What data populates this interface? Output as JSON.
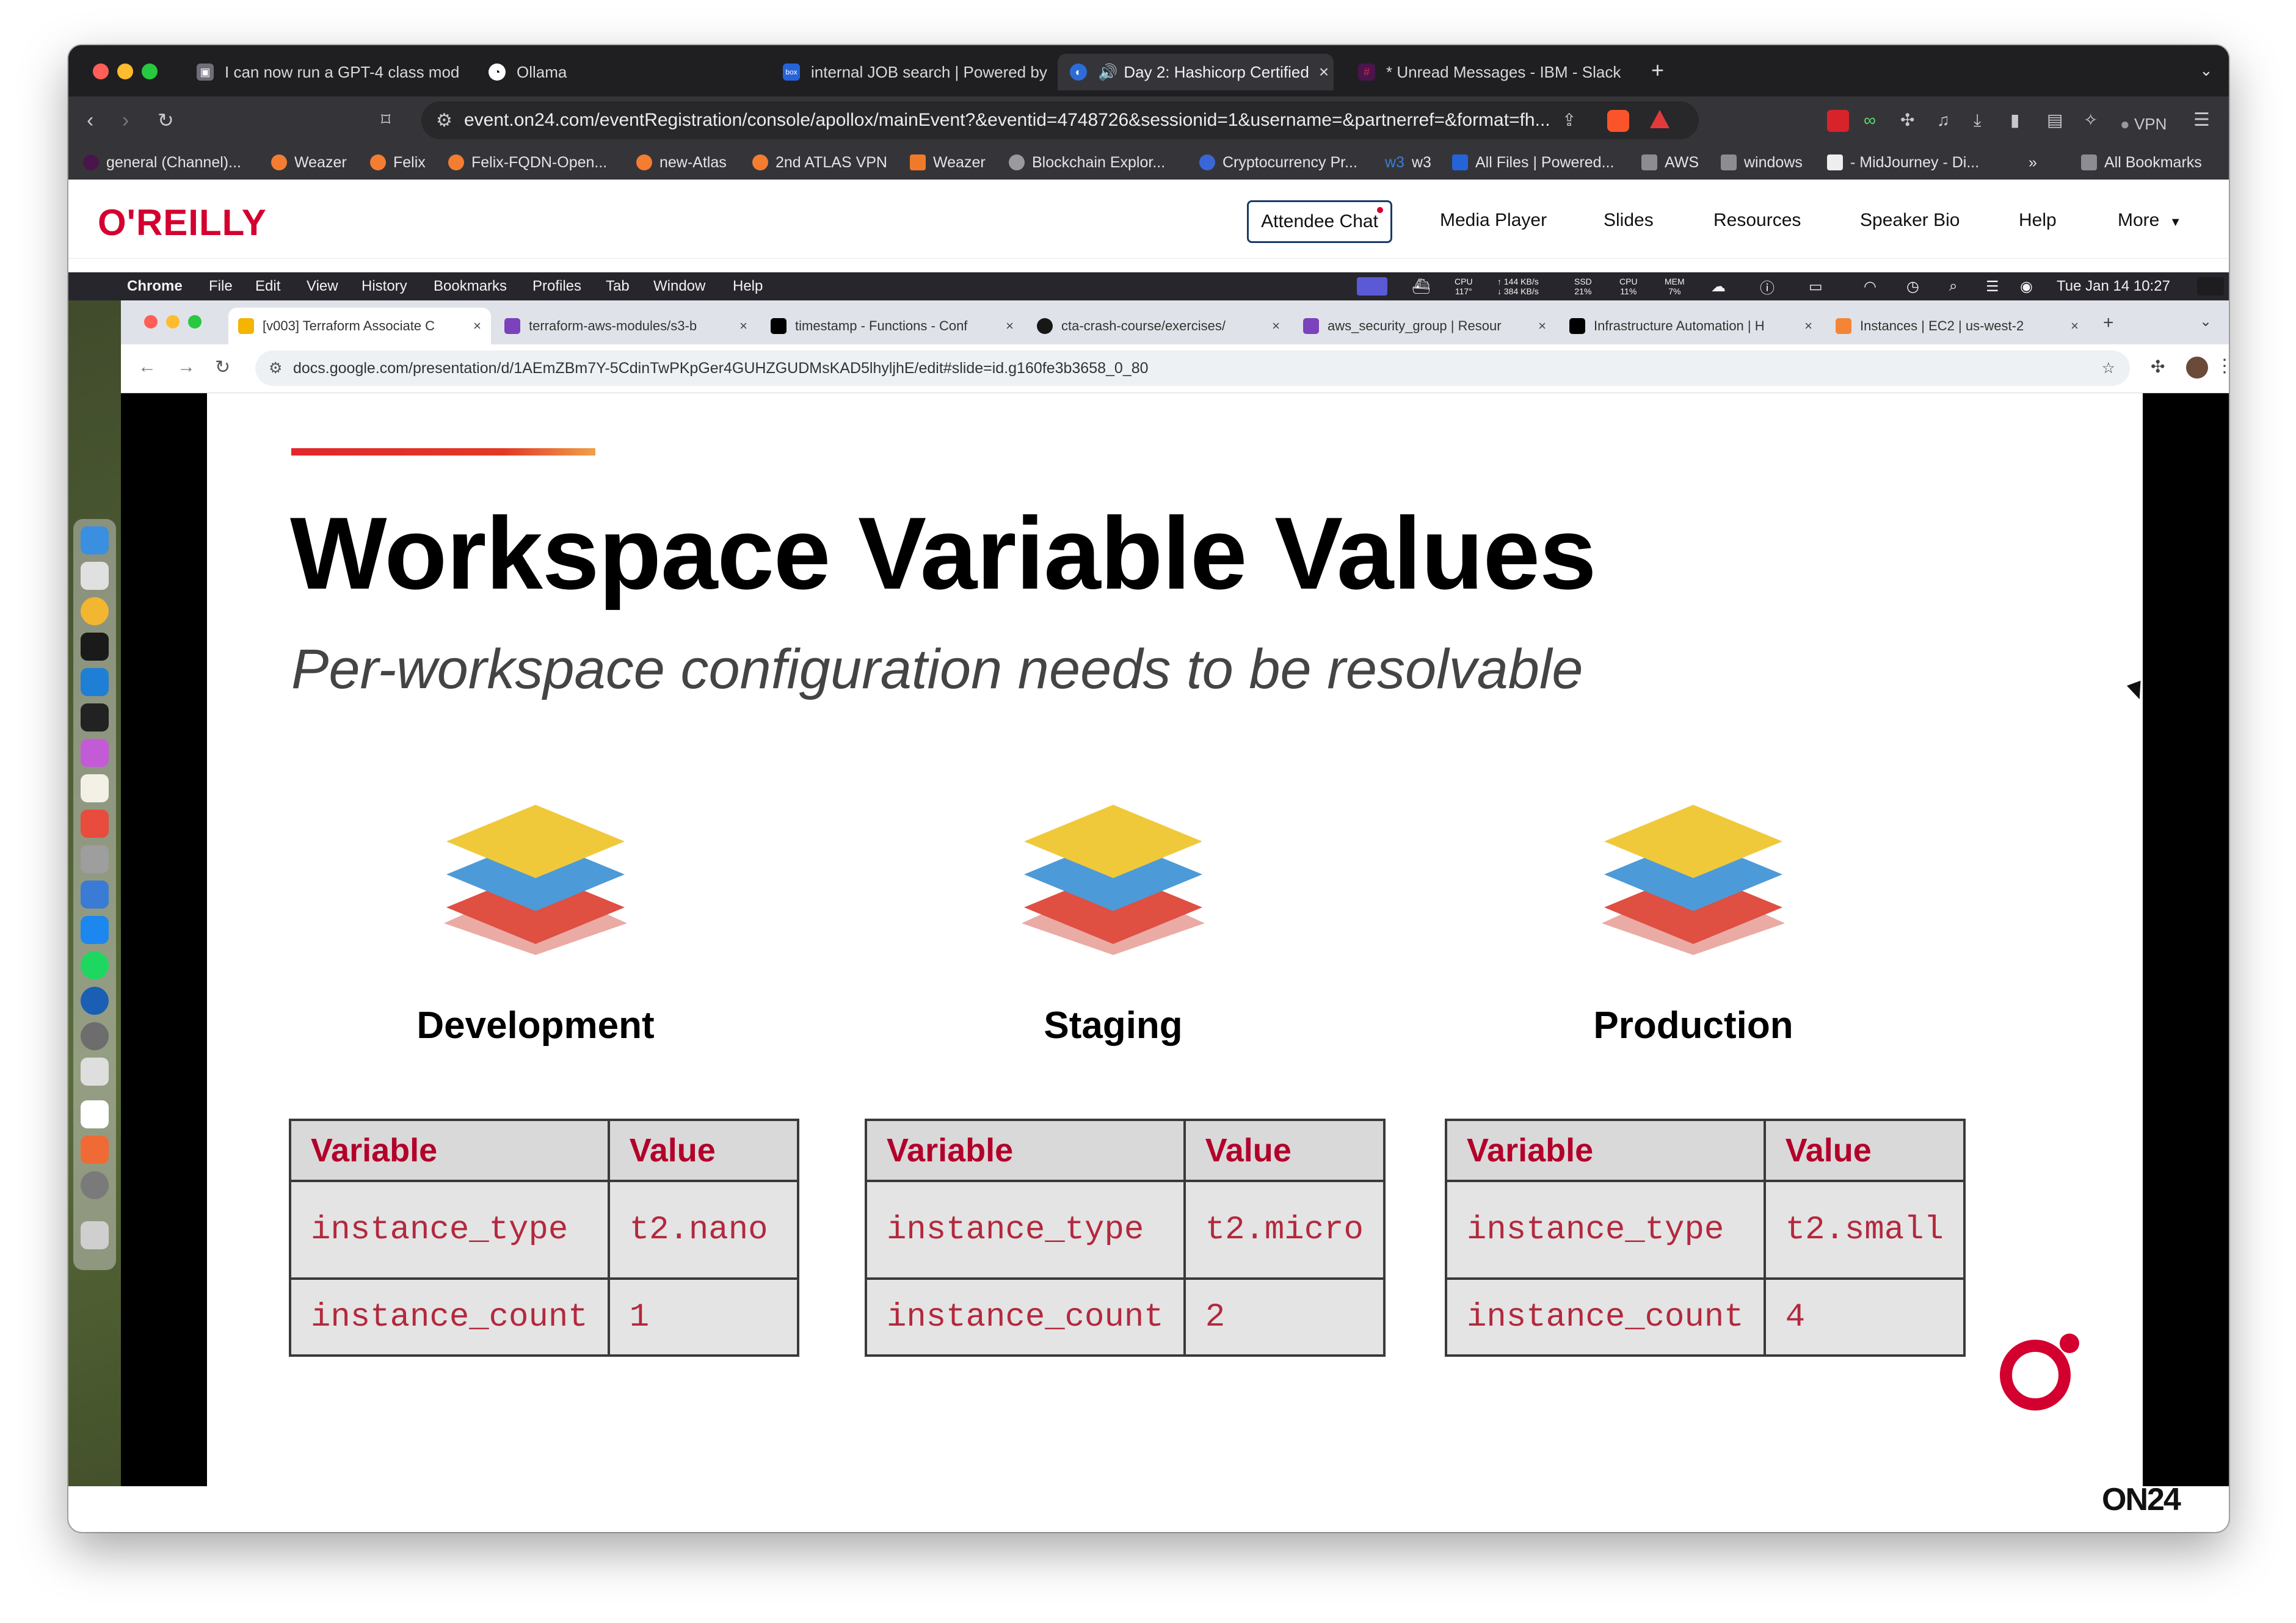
{
  "browser": {
    "tabs": [
      {
        "label": "I can now run a GPT-4 class mod",
        "color": "#7a7a86"
      },
      {
        "label": "Ollama",
        "color": "#ffffff"
      },
      {
        "label": "internal JOB search | Powered by",
        "color": "#2564d8"
      },
      {
        "label": "Day 2: Hashicorp Certified",
        "color": "#2d6bd8"
      },
      {
        "label": "* Unread Messages - IBM - Slack",
        "color": "#e01e5a"
      }
    ],
    "url": "event.on24.com/eventRegistration/console/apollox/mainEvent?&eventid=4748726&sessionid=1&username=&partnerref=&format=fh...",
    "vpn_label": "VPN",
    "bookmarks": [
      "general (Channel)...",
      "Weazer",
      "Felix",
      "Felix-FQDN-Open...",
      "new-Atlas",
      "2nd ATLAS VPN",
      "Weazer",
      "Blockchain Explor...",
      "Cryptocurrency Pr...",
      "w3",
      "All Files | Powered...",
      "AWS",
      "windows",
      "- MidJourney - Di...",
      "All Bookmarks"
    ]
  },
  "oreilly": {
    "logo": "O'REILLY",
    "nav": [
      "Attendee Chat",
      "Media Player",
      "Slides",
      "Resources",
      "Speaker Bio",
      "Help",
      "More"
    ]
  },
  "mac_menu": {
    "app": "Chrome",
    "items": [
      "File",
      "Edit",
      "View",
      "History",
      "Bookmarks",
      "Profiles",
      "Tab",
      "Window",
      "Help"
    ],
    "clock": "Tue Jan 14  10:27",
    "stats": {
      "cpu1": "117°",
      "net_up": "144 KB/s",
      "net_down": "384 KB/s",
      "ssd": "21%",
      "cpu2": "11%",
      "mem": "7%"
    }
  },
  "inner_chrome": {
    "tabs": [
      "[v003] Terraform Associate C",
      "terraform-aws-modules/s3-b",
      "timestamp - Functions - Conf",
      "cta-crash-course/exercises/",
      "aws_security_group | Resour",
      "Infrastructure Automation | H",
      "Instances | EC2 | us-west-2"
    ],
    "url": "docs.google.com/presentation/d/1AEmZBm7Y-5CdinTwPKpGer4GUHZGUDMsKAD5lhyljhE/edit#slide=id.g160fe3b3658_0_80"
  },
  "slide": {
    "title": "Workspace Variable Values",
    "subtitle": "Per-workspace configuration needs to be resolvable",
    "environments": [
      {
        "name": "Development",
        "header_variable": "Variable",
        "header_value": "Value",
        "rows": [
          {
            "variable": "instance_type",
            "value": "t2.nano"
          },
          {
            "variable": "instance_count",
            "value": "1"
          }
        ]
      },
      {
        "name": "Staging",
        "header_variable": "Variable",
        "header_value": "Value",
        "rows": [
          {
            "variable": "instance_type",
            "value": "t2.micro"
          },
          {
            "variable": "instance_count",
            "value": "2"
          }
        ]
      },
      {
        "name": "Production",
        "header_variable": "Variable",
        "header_value": "Value",
        "rows": [
          {
            "variable": "instance_type",
            "value": "t2.small"
          },
          {
            "variable": "instance_count",
            "value": "4"
          }
        ]
      }
    ],
    "layer_colors": {
      "top": "#f0c93a",
      "middle": "#4d9ad8",
      "bottom": "#df4f42"
    }
  },
  "watermark": "ON24"
}
